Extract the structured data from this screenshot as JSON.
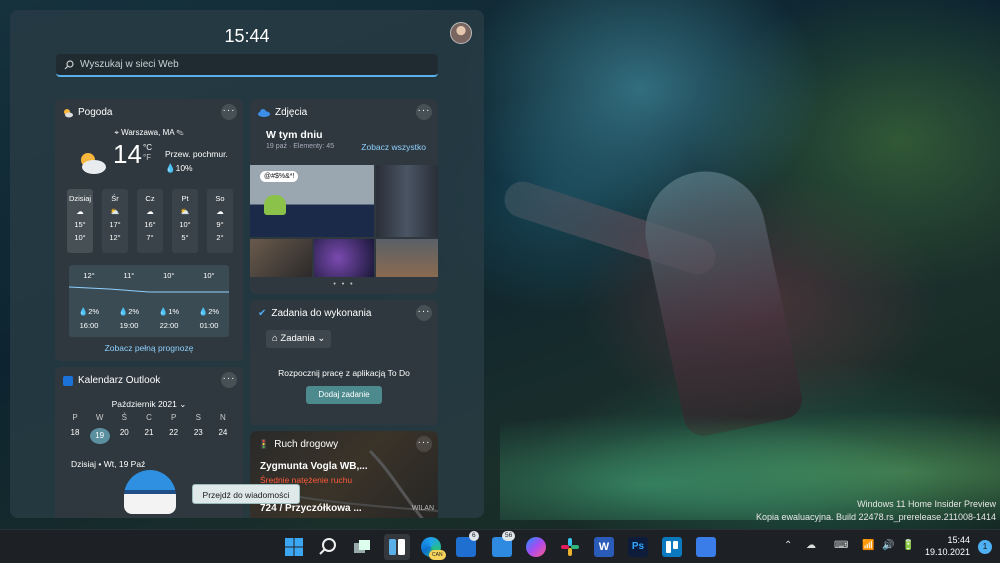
{
  "panel": {
    "clock": "15:44",
    "search_placeholder": "Wyszukaj w sieci Web"
  },
  "weather": {
    "title": "Pogoda",
    "location": "Warszawa, MA",
    "temp": "14",
    "unit_c": "°C",
    "unit_f": "°F",
    "condition": "Przew. pochmur.",
    "precip": "10%",
    "days": [
      {
        "name": "Dzisiaj",
        "hi": "15°",
        "lo": "10°"
      },
      {
        "name": "Śr",
        "hi": "17°",
        "lo": "12°"
      },
      {
        "name": "Cz",
        "hi": "16°",
        "lo": "7°"
      },
      {
        "name": "Pt",
        "hi": "10°",
        "lo": "5°"
      },
      {
        "name": "So",
        "hi": "9°",
        "lo": "2°"
      }
    ],
    "hourly": {
      "temps": [
        "12°",
        "11°",
        "10°",
        "10°"
      ],
      "precip": [
        "2%",
        "2%",
        "1%",
        "2%"
      ],
      "times": [
        "16:00",
        "19:00",
        "22:00",
        "01:00"
      ]
    },
    "link": "Zobacz pełną prognozę"
  },
  "photos": {
    "title": "Zdjęcia",
    "heading": "W tym dniu",
    "sub": "19 paź · Elementy: 45",
    "link": "Zobacz wszystko",
    "meme_text": "@#$%&*!"
  },
  "todo": {
    "title": "Zadania do wykonania",
    "list": "Zadania",
    "message": "Rozpocznij pracę z aplikacją To Do",
    "button": "Dodaj zadanie"
  },
  "calendar": {
    "title": "Kalendarz Outlook",
    "month": "Październik 2021",
    "weekdays": [
      "P",
      "W",
      "Ś",
      "C",
      "P",
      "S",
      "N"
    ],
    "dates": [
      "18",
      "19",
      "20",
      "21",
      "22",
      "23",
      "24"
    ],
    "today_line": "Dzisiaj • Wt, 19 Paź"
  },
  "traffic": {
    "title": "Ruch drogowy",
    "street": "Zygmunta Vogla WB,...",
    "status": "Średnie natężenie ruchu",
    "road": "724 / Przyczółkowa ...",
    "map_label": "WILAN"
  },
  "tooltip": "Przejdź do wiadomości",
  "watermark": {
    "line1": "Windows 11 Home Insider Preview",
    "line2": "Kopia ewaluacyjna. Build 22478.rs_prerelease.211008-1414"
  },
  "taskbar": {
    "time": "15:44",
    "date": "19.10.2021",
    "notifications": "1",
    "mail_badge": "6",
    "app_badge": "56",
    "edge_badge": "CAN"
  },
  "colors": {
    "accent": "#5ab0e8",
    "link": "#8fd0ff",
    "traffic_status": "#ff5a3c"
  }
}
